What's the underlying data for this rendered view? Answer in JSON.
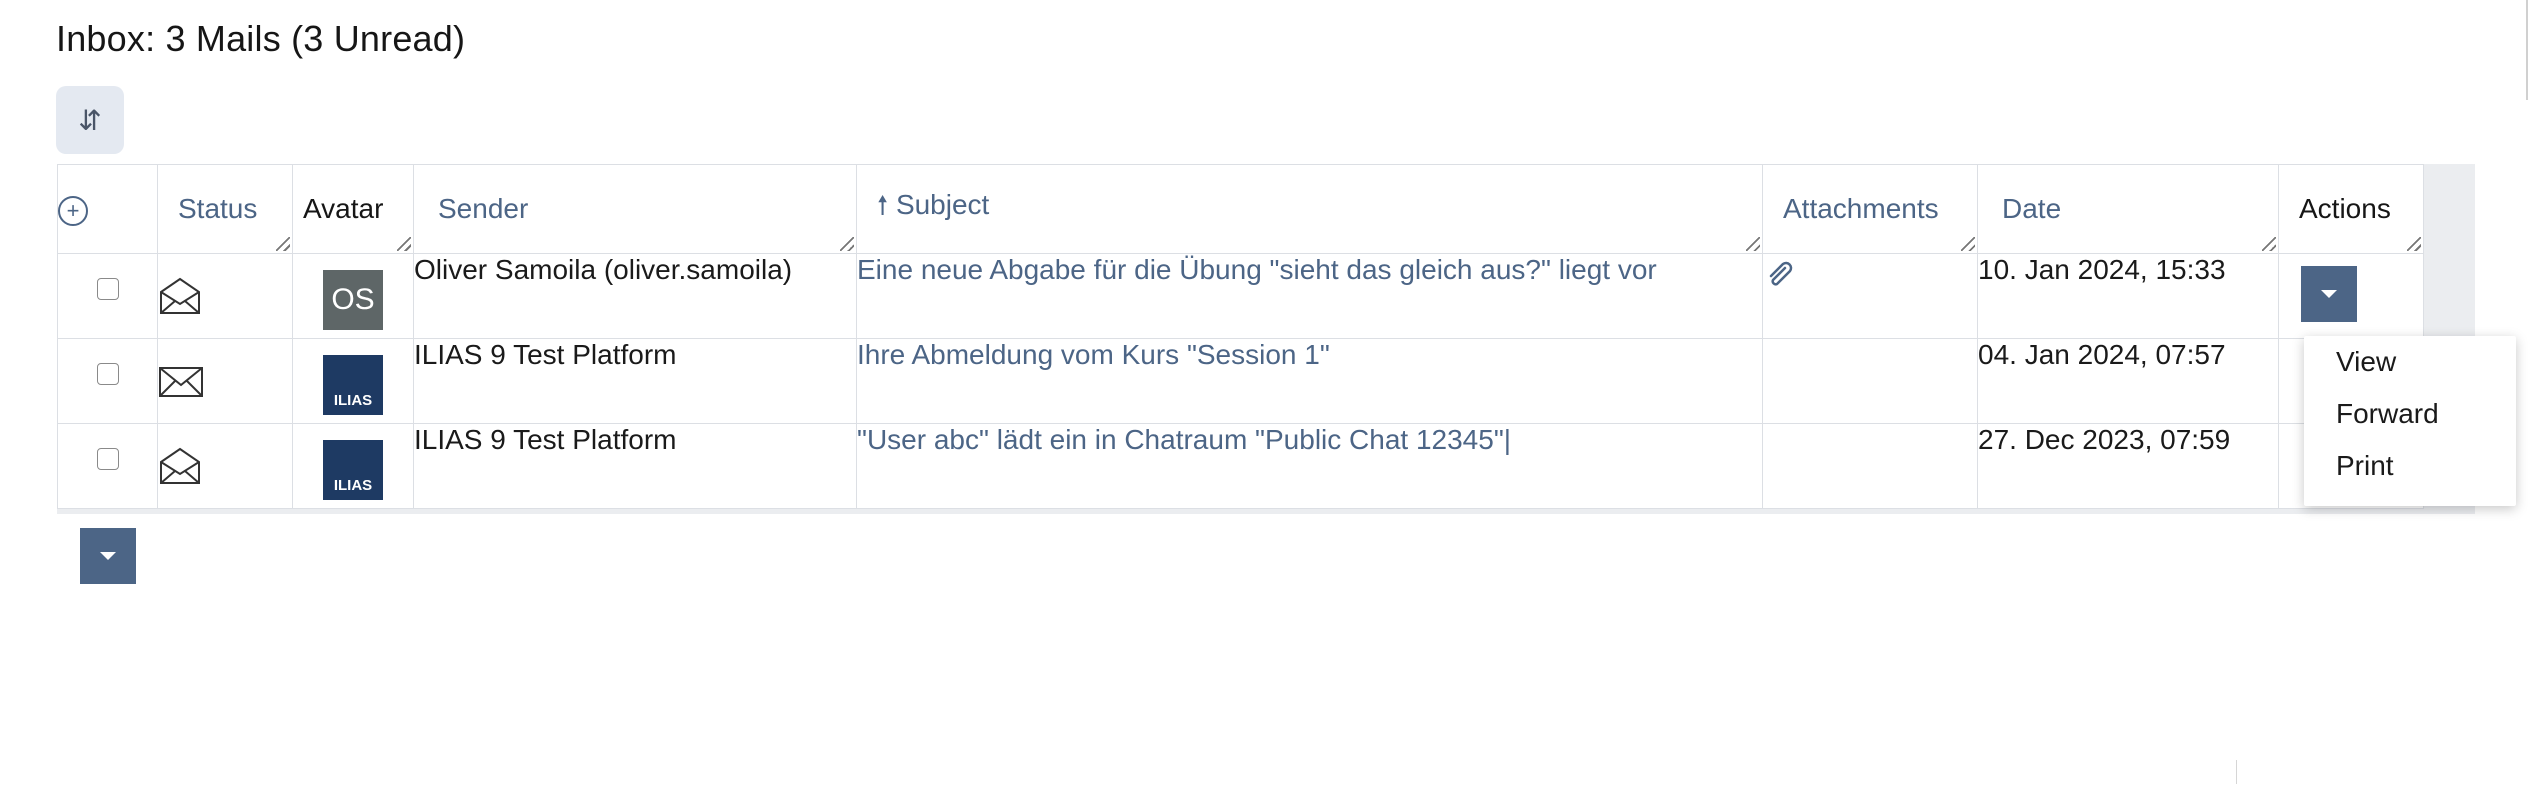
{
  "inbox": {
    "title": "Inbox: 3 Mails (3 Unread)"
  },
  "toolbar": {
    "sort_icon": "⇵"
  },
  "table": {
    "headers": {
      "select_all_icon": "+",
      "status": "Status",
      "avatar": "Avatar",
      "sender": "Sender",
      "subject": "Subject",
      "subject_sort_icon": "🠕",
      "attachments": "Attachments",
      "date": "Date",
      "actions": "Actions"
    },
    "rows": [
      {
        "status": "read-envelope-icon",
        "avatar_text": "OS",
        "sender": "Oliver Samoila (oliver.samoila)",
        "subject": "Eine neue Abgabe für die Übung \"sieht das gleich aus?\" liegt vor",
        "attachment": "paperclip-icon",
        "date": "10. Jan 2024, 15:33"
      },
      {
        "status": "unread-envelope-icon",
        "avatar_text": "ILIAS",
        "sender": "ILIAS 9 Test Platform",
        "subject": "Ihre Abmeldung vom Kurs \"Session 1\"",
        "attachment": "",
        "date": "04. Jan 2024, 07:57"
      },
      {
        "status": "read-envelope-icon",
        "avatar_text": "ILIAS",
        "sender": "ILIAS 9 Test Platform",
        "subject": "\"User abc\" lädt ein in Chatraum \"Public Chat 12345\"|",
        "attachment": "",
        "date": "27. Dec 2023, 07:59"
      }
    ]
  },
  "actions_menu": {
    "items": [
      "View",
      "Forward",
      "Print"
    ]
  },
  "colors": {
    "accent": "#4c6586",
    "avatar_initials_bg": "#5e6667",
    "avatar_ilias_bg": "#1e3a63"
  }
}
